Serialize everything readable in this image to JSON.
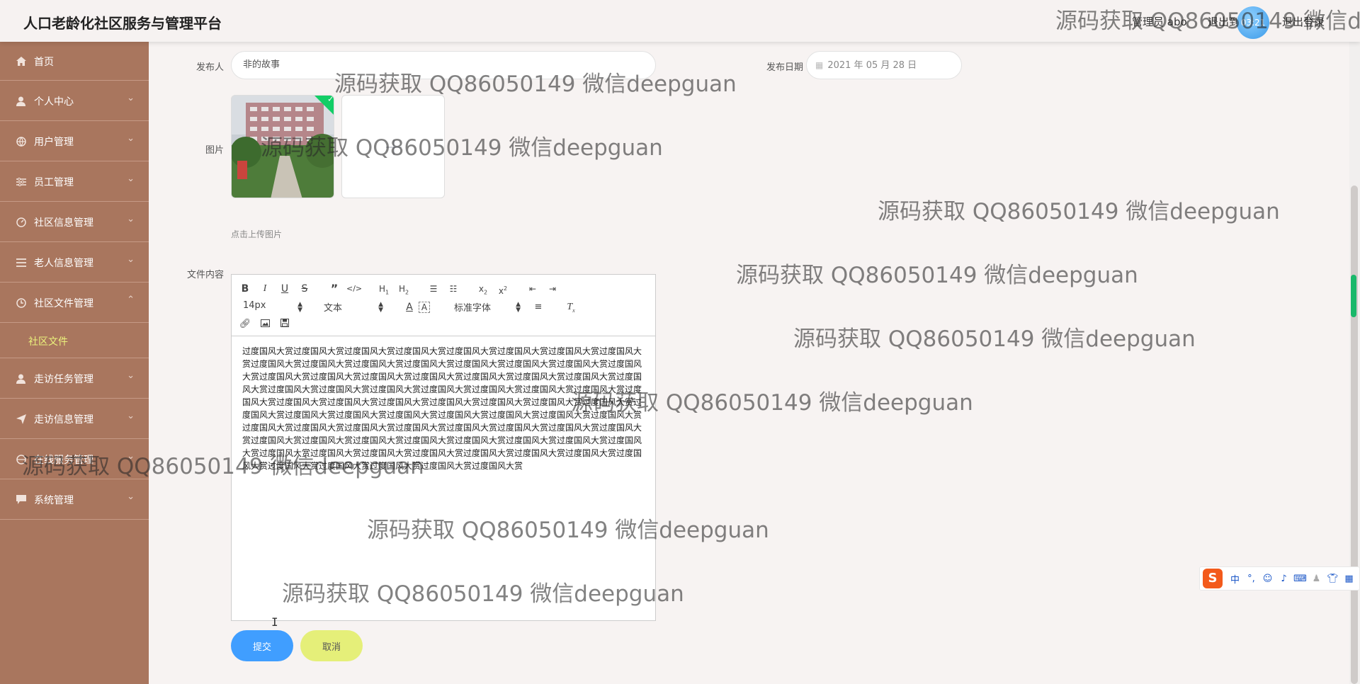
{
  "header": {
    "app_title": "人口老龄化社区服务与管理平台",
    "user_label": "管理员 abo",
    "logout_label": "退出到",
    "time_badge": "03:21",
    "exit_label": "退出登录"
  },
  "sidebar": {
    "items": [
      {
        "label": "首页",
        "icon": "home-icon"
      },
      {
        "label": "个人中心",
        "icon": "user-icon"
      },
      {
        "label": "用户管理",
        "icon": "globe-icon"
      },
      {
        "label": "员工管理",
        "icon": "sliders-icon"
      },
      {
        "label": "社区信息管理",
        "icon": "gauge-icon"
      },
      {
        "label": "老人信息管理",
        "icon": "menu-icon"
      },
      {
        "label": "社区文件管理",
        "icon": "clock-icon",
        "expanded": true
      },
      {
        "label": "走访任务管理",
        "icon": "user-icon"
      },
      {
        "label": "走访信息管理",
        "icon": "send-icon"
      },
      {
        "label": "在线服务管理",
        "icon": "globe-icon"
      },
      {
        "label": "系统管理",
        "icon": "chat-icon"
      }
    ],
    "submenu": {
      "label": "社区文件"
    }
  },
  "form": {
    "publisher_label": "发布人",
    "publisher_value": "非的故事",
    "date_label": "发布日期",
    "date_value": "2021 年 05 月 28 日",
    "image_label": "图片",
    "upload_hint": "点击上传图片",
    "content_label": "文件内容",
    "toolbar": {
      "font_size": "14px",
      "text_type": "文本",
      "font_family": "标准字体"
    },
    "content_text": "过度国风大赏过度国风大赏过度国风大赏过度国风大赏过度国风大赏过度国风大赏过度国风大赏过度国风大赏过度国风大赏过度国风大赏过度国风大赏过度国风大赏过度国风大赏过度国风大赏过度国风大赏过度国风大赏过度国风大赏过度国风大赏过度国风大赏过度国风大赏过度国风大赏过度国风大赏过度国风大赏过度国风大赏过度国风大赏过度国风大赏过度国风大赏过度国风大赏过度国风大赏过度国风大赏过度国风大赏过度国风大赏过度国风大赏过度国风大赏过度国风大赏过度国风大赏过度国风大赏过度国风大赏过度国风大赏过度国风大赏过度国风大赏过度国风大赏过度国风大赏过度国风大赏过度国风大赏过度国风大赏过度国风大赏过度国风大赏过度国风大赏过度国风大赏过度国风大赏过度国风大赏过度国风大赏过度国风大赏过度国风大赏过度国风大赏过度国风大赏过度国风大赏过度国风大赏过度国风大赏过度国风大赏过度国风大赏过度国风大赏过度国风大赏过度国风大赏过度国风大赏过度国风大赏过度国风大赏过度国风大赏过度国风大赏过度国风大赏过度国风大赏过度国风大赏过度国风大赏过度国风大赏过度国风大赏",
    "submit_label": "提交",
    "cancel_label": "取消"
  },
  "watermark": {
    "text": "源码获取 QQ86050149 微信deepguan"
  },
  "colors": {
    "sidebar_bg": "#a9765e",
    "submenu_text": "#ecf37c",
    "submit_bg": "#409eff",
    "cancel_bg": "#e5ef79",
    "page_bg": "#f7f3f2"
  }
}
